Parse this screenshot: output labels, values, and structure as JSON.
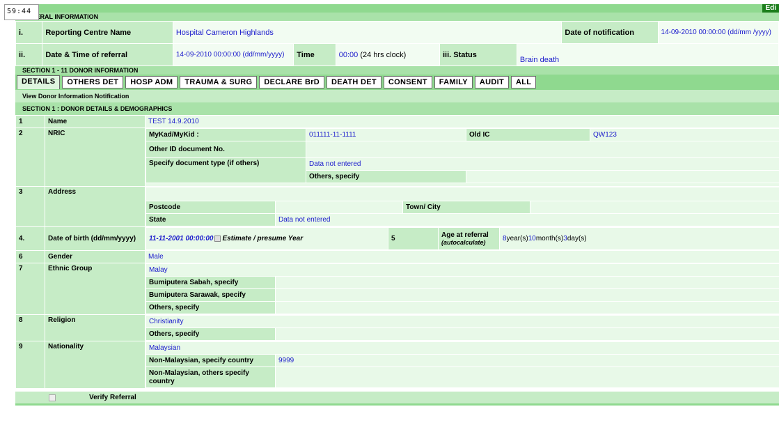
{
  "timer": "59:44",
  "edit_label": "Edi",
  "general": {
    "title": "GENERAL INFORMATION",
    "row1_num": "i.",
    "centre_label": "Reporting Centre Name",
    "centre_value": "Hospital Cameron Highlands",
    "notif_label": "Date of notification",
    "notif_value": "14-09-2010 00:00:00  (dd/mm /yyyy)",
    "row2_num": "ii.",
    "referral_label": "Date & Time of referral",
    "referral_value": "14-09-2010 00:00:00 (dd/mm/yyyy)",
    "time_label": "Time",
    "time_value": "00:00",
    "time_suffix": "(24 hrs clock)",
    "status_label": "iii. Status",
    "status_value": "Brain death"
  },
  "section_donor": "SECTION 1 - 11 DONOR INFORMATION",
  "tabs": [
    "DETAILS",
    "OTHERS DET",
    "HOSP ADM",
    "TRAUMA & SURG",
    "DECLARE BrD",
    "DEATH DET",
    "CONSENT",
    "FAMILY",
    "AUDIT",
    "ALL"
  ],
  "view_label": "View Donor Information Notification",
  "section_details": "SECTION 1 : DONOR DETAILS & DEMOGRAPHICS",
  "rows": {
    "name": {
      "num": "1",
      "label": "Name",
      "value": "TEST 14.9.2010"
    },
    "nric": {
      "num": "2",
      "label": "NRIC",
      "mykad_label": "MyKad/MyKid :",
      "mykad_value": "011111-11-1111",
      "oldic_label": "Old IC",
      "oldic_value": "QW123",
      "otherid_label": "Other ID document No.",
      "doctype_label": "Specify document type (if others)",
      "doctype_value": "Data not entered",
      "others_label": "Others, specify"
    },
    "address": {
      "num": "3",
      "label": "Address",
      "postcode_label": "Postcode",
      "town_label": "Town/ City",
      "state_label": "State",
      "state_value": "Data not entered"
    },
    "dob": {
      "num": "4.",
      "label": "Date of birth (dd/mm/yyyy)",
      "value": "11-11-2001 00:00:00",
      "estimate": "Estimate / presume Year",
      "age_num": "5",
      "age_label": "Age at referral",
      "age_sub": "(autocalculate)",
      "years": "8",
      "years_lbl": "year(s)",
      "months": "10",
      "months_lbl": "month(s)",
      "days": "3",
      "days_lbl": "day(s)"
    },
    "gender": {
      "num": "6",
      "label": "Gender",
      "value": "Male"
    },
    "ethnic": {
      "num": "7",
      "label": "Ethnic Group",
      "value": "Malay",
      "sabah": "Bumiputera Sabah, specify",
      "sarawak": "Bumiputera Sarawak, specify",
      "others": "Others, specify"
    },
    "religion": {
      "num": "8",
      "label": "Religion",
      "value": "Christianity",
      "others": "Others, specify"
    },
    "nationality": {
      "num": "9",
      "label": "Nationality",
      "value": "Malaysian",
      "nonmy_label": "Non-Malaysian, specify country",
      "nonmy_value": "9999",
      "nonmy_others": "Non-Malaysian, others specify country"
    }
  },
  "verify_label": "Verify Referral"
}
